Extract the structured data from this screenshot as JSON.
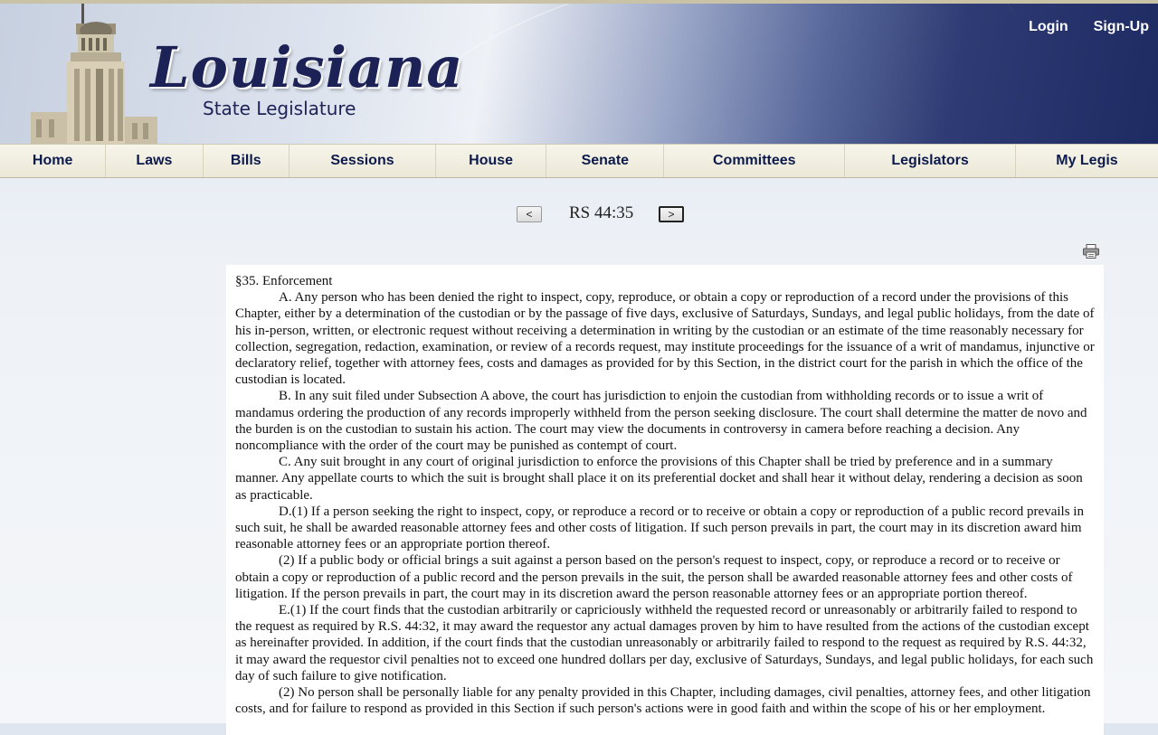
{
  "header": {
    "logo_title": "Louisiana",
    "logo_subtitle": "State Legislature",
    "login": "Login",
    "signup": "Sign-Up"
  },
  "nav": [
    "Home",
    "Laws",
    "Bills",
    "Sessions",
    "House",
    "Senate",
    "Committees",
    "Legislators",
    "My Legis"
  ],
  "pager": {
    "prev": "<",
    "next": ">",
    "section": "RS 44:35"
  },
  "document": {
    "heading": "§35. Enforcement",
    "paragraphs": [
      "A. Any person who has been denied the right to inspect, copy, reproduce, or obtain a copy or reproduction of a record under the provisions of this Chapter, either by a determination of the custodian or by the passage of five days, exclusive of Saturdays, Sundays, and legal public holidays, from the date of his in-person, written, or electronic request without receiving a determination in writing by the custodian or an estimate of the time reasonably necessary for collection, segregation, redaction, examination, or review of a records request, may institute proceedings for the issuance of a writ of mandamus, injunctive or declaratory relief, together with attorney fees, costs and damages as provided for by this Section, in the district court for the parish in which the office of the custodian is located.",
      "B. In any suit filed under Subsection A above, the court has jurisdiction to enjoin the custodian from withholding records or to issue a writ of mandamus ordering the production of any records improperly withheld from the person seeking disclosure. The court shall determine the matter de novo and the burden is on the custodian to sustain his action. The court may view the documents in controversy in camera before reaching a decision. Any noncompliance with the order of the court may be punished as contempt of court.",
      "C. Any suit brought in any court of original jurisdiction to enforce the provisions of this Chapter shall be tried by preference and in a summary manner. Any appellate courts to which the suit is brought shall place it on its preferential docket and shall hear it without delay, rendering a decision as soon as practicable.",
      "D.(1) If a person seeking the right to inspect, copy, or reproduce a record or to receive or obtain a copy or reproduction of a public record prevails in such suit, he shall be awarded reasonable attorney fees and other costs of litigation. If such person prevails in part, the court may in its discretion award him reasonable attorney fees or an appropriate portion thereof.",
      "(2) If a public body or official brings a suit against a person based on the person's request to inspect, copy, or reproduce a record or to receive or obtain a copy or reproduction of a public record and the person prevails in the suit, the person shall be awarded reasonable attorney fees and other costs of litigation. If the person prevails in part, the court may in its discretion award the person reasonable attorney fees or an appropriate portion thereof.",
      "E.(1) If the court finds that the custodian arbitrarily or capriciously withheld the requested record or unreasonably or arbitrarily failed to respond to the request as required by R.S. 44:32, it may award the requestor any actual damages proven by him to have resulted from the actions of the custodian except as hereinafter provided. In addition, if the court finds that the custodian unreasonably or arbitrarily failed to respond to the request as required by R.S. 44:32, it may award the requestor civil penalties not to exceed one hundred dollars per day, exclusive of Saturdays, Sundays, and legal public holidays, for each such day of such failure to give notification.",
      "(2) No person shall be personally liable for any penalty provided in this Chapter, including damages, civil penalties, attorney fees, and other litigation costs, and for failure to respond as provided in this Section if such person's actions were in good faith and within the scope of his or her employment."
    ]
  }
}
